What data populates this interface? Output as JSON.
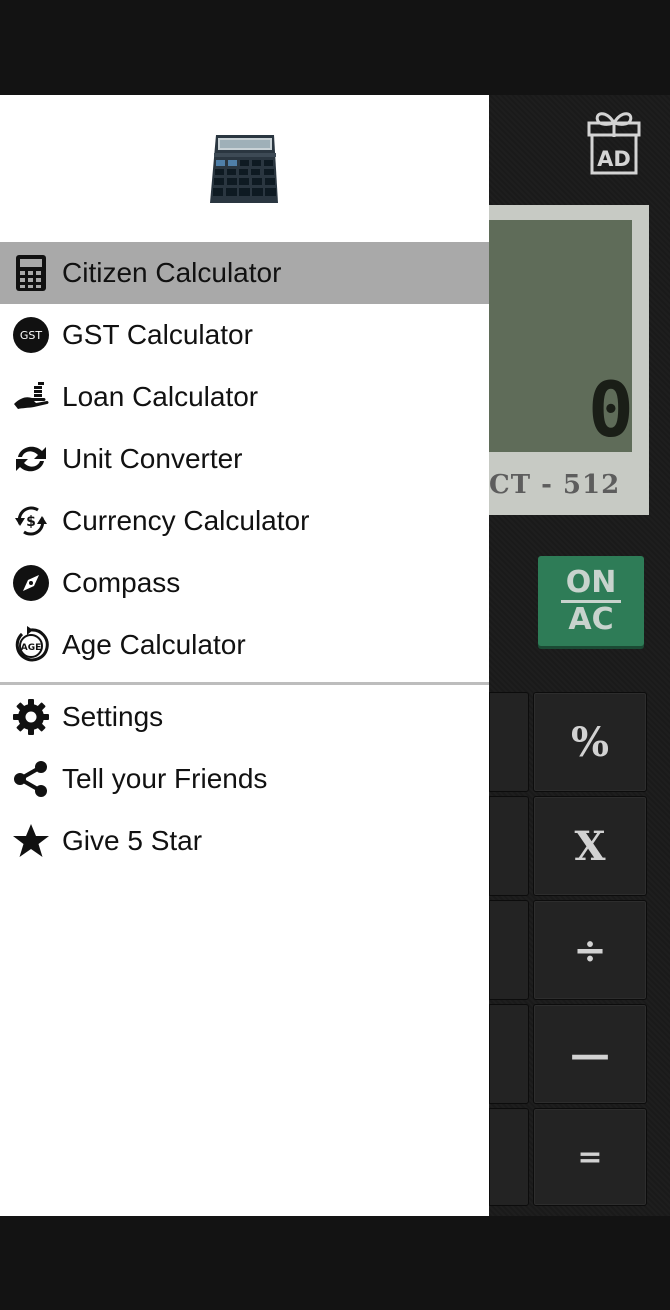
{
  "drawer": {
    "primary_items": [
      {
        "label": "Citizen Calculator",
        "icon": "calculator-icon",
        "active": true
      },
      {
        "label": "GST Calculator",
        "icon": "gst-icon",
        "icon_text": "GST"
      },
      {
        "label": "Loan Calculator",
        "icon": "loan-hand-icon"
      },
      {
        "label": "Unit Converter",
        "icon": "convert-arrows-icon"
      },
      {
        "label": "Currency Calculator",
        "icon": "currency-exchange-icon"
      },
      {
        "label": "Compass",
        "icon": "compass-icon"
      },
      {
        "label": "Age Calculator",
        "icon": "age-icon",
        "icon_text": "AGE"
      }
    ],
    "secondary_items": [
      {
        "label": "Settings",
        "icon": "gear-icon"
      },
      {
        "label": "Tell your Friends",
        "icon": "share-icon"
      },
      {
        "label": "Give 5 Star",
        "icon": "star-icon"
      }
    ]
  },
  "app": {
    "ad_label": "AD",
    "display_value": "0",
    "model_text": "CT - 512",
    "on_label": "ON",
    "ac_label": "AC",
    "keys": [
      "%",
      "X",
      "÷",
      "—",
      "="
    ]
  },
  "colors": {
    "active_item_bg": "#a9a9a9",
    "on_ac_button": "#2e7c57",
    "lcd": "#5f6c59"
  }
}
